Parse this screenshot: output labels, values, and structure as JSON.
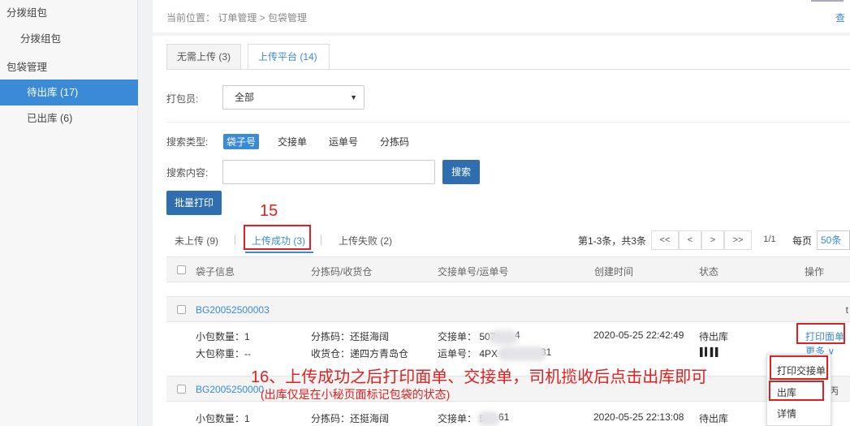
{
  "sidebar": {
    "items": [
      {
        "label": "分拨组包"
      },
      {
        "label": "分拨组包"
      },
      {
        "label": "包袋管理"
      },
      {
        "label": "待出库 (17)"
      },
      {
        "label": "已出库 (6)"
      }
    ]
  },
  "breadcrumb": {
    "text": "当前位置：  订单管理 > 包袋管理",
    "link": "查"
  },
  "tabs": [
    {
      "label": "无需上传 (3)"
    },
    {
      "label": "上传平台 (14)"
    }
  ],
  "filter": {
    "packer_label": "打包员:",
    "packer_value": "全部"
  },
  "search": {
    "type_label": "搜索类型:",
    "types": [
      "袋子号",
      "交接单",
      "运单号",
      "分拣码"
    ],
    "content_label": "搜索内容:",
    "input_value": "",
    "search_button": "搜索",
    "batch_print_button": "批量打印"
  },
  "subtabs": [
    {
      "label": "未上传 (9)"
    },
    {
      "label": "上传成功 (3)"
    },
    {
      "label": "上传失败 (2)"
    }
  ],
  "pager": {
    "info": "第1-3条，共3条",
    "buttons": [
      "<<",
      "<",
      ">",
      ">>"
    ],
    "page": "1/1",
    "per_label": "每页",
    "per_value": "50条"
  },
  "table": {
    "headers": [
      "袋子信息",
      "分拣码/收货仓",
      "交接单号/运单号",
      "创建时间",
      "状态",
      "操作"
    ],
    "groups": [
      {
        "bag_id": "BG20052500003",
        "count": "小包数量：1",
        "weight": "大包称重：--",
        "sort_code": "分拣码：还挺海阔",
        "warehouse": "收货仓：递四方青岛仓",
        "handover": "交接单：  507",
        "handover_tail": "4",
        "waybill": "运单号：  4PX",
        "waybill_tail": "31",
        "created": "2020-05-25 22:42:49",
        "status": "待出库",
        "action_print": "打印面单",
        "action_more": "更多 ∨",
        "trailing": "t"
      },
      {
        "bag_id": "BG2005250000",
        "count": "小包数量：1",
        "sort_code": "分拣码：还挺海阔",
        "handover": "交接单：  5",
        "handover_tail": "61",
        "created": "2020-05-25 22:13:08",
        "status": "待出库",
        "trailing": "丙"
      }
    ]
  },
  "dropdown": {
    "items": [
      "打印交接单",
      "出库",
      "详情"
    ]
  },
  "annotations": {
    "step15": "15",
    "step16": "16、上传成功之后打印面单、交接单，司机揽收后点击出库即可",
    "note": "(出库仅是在小秘页面标记包袋的状态)"
  },
  "colors": {
    "accent": "#3a8ad6",
    "button": "#2f6fb0",
    "annotation": "#e02020"
  }
}
